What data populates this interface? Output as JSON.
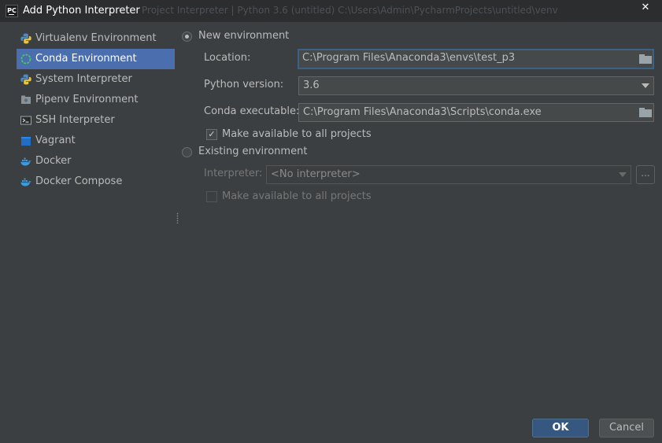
{
  "window": {
    "title": "Add Python Interpreter",
    "app_icon_text": "PC",
    "background_ghost_text": "Project Interpreter   |   Python 3.6 (untitled)   C:\\Users\\Admin\\PycharmProjects\\untitled\\venv",
    "close_glyph": "✕"
  },
  "sidebar": {
    "items": [
      {
        "label": "Virtualenv Environment",
        "icon": "python-icon"
      },
      {
        "label": "Conda Environment",
        "icon": "conda-icon",
        "selected": true
      },
      {
        "label": "System Interpreter",
        "icon": "python-icon"
      },
      {
        "label": "Pipenv Environment",
        "icon": "pipenv-icon"
      },
      {
        "label": "SSH Interpreter",
        "icon": "terminal-icon"
      },
      {
        "label": "Vagrant",
        "icon": "vagrant-icon"
      },
      {
        "label": "Docker",
        "icon": "docker-icon"
      },
      {
        "label": "Docker Compose",
        "icon": "docker-icon"
      }
    ]
  },
  "new_env": {
    "radio_label": "New environment",
    "location_label": "Location:",
    "location_value": "C:\\Program Files\\Anaconda3\\envs\\test_p3",
    "python_version_label": "Python version:",
    "python_version_value": "3.6",
    "conda_exec_label": "Conda executable:",
    "conda_exec_value": "C:\\Program Files\\Anaconda3\\Scripts\\conda.exe",
    "make_available_label": "Make available to all projects",
    "check_glyph": "✓"
  },
  "existing_env": {
    "radio_label": "Existing environment",
    "interpreter_label": "Interpreter:",
    "interpreter_value": "<No interpreter>",
    "more_button_label": "...",
    "make_available_label": "Make available to all projects"
  },
  "buttons": {
    "ok": "OK",
    "cancel": "Cancel"
  },
  "colors": {
    "background": "#3c3f41",
    "selection": "#4b6eaf",
    "ok_button": "#365880",
    "focus_border": "#3d6185"
  }
}
